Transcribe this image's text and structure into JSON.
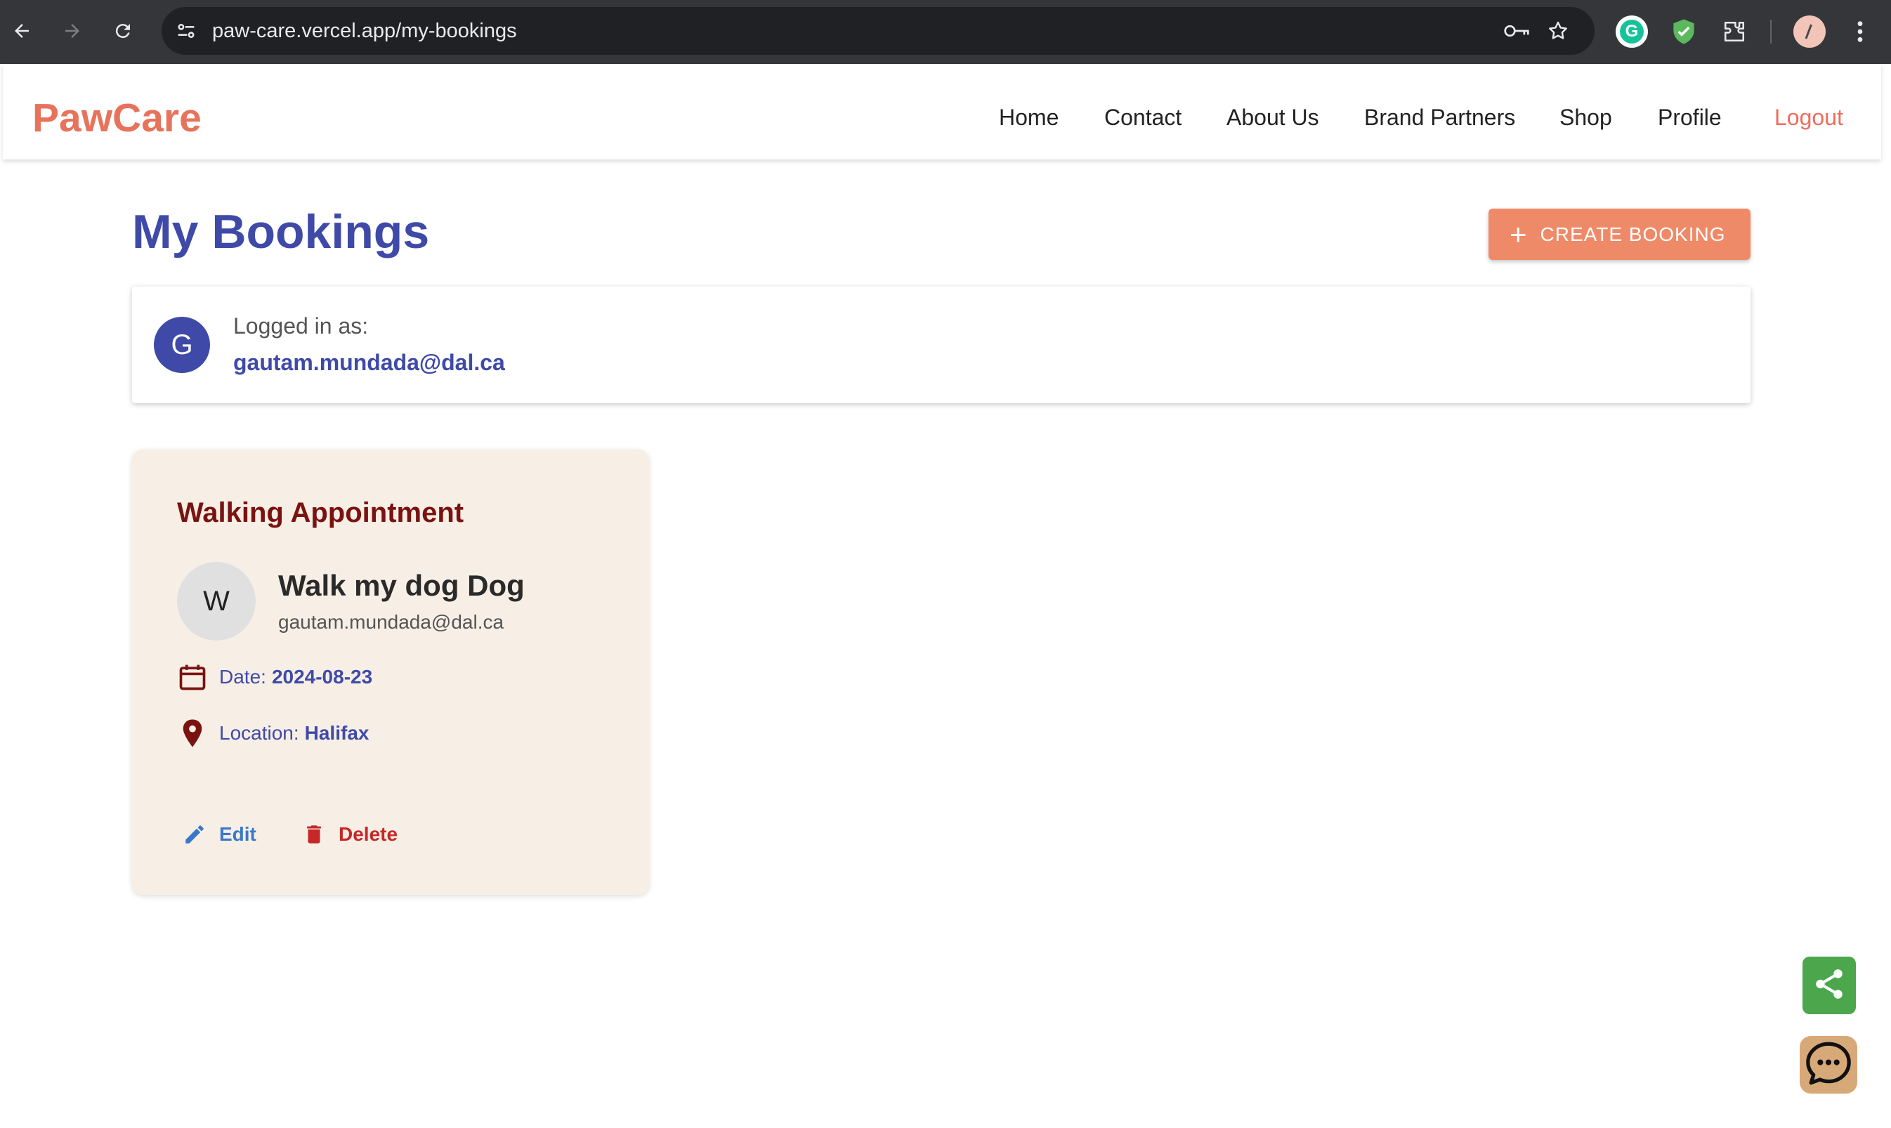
{
  "browser": {
    "url": "paw-care.vercel.app/my-bookings",
    "extensions": [
      "grammarly-icon",
      "shield-icon",
      "puzzle-icon"
    ],
    "colors": {
      "chrome_bg": "#35363a",
      "omnibox_bg": "#202124"
    }
  },
  "navbar": {
    "brand": "PawCare",
    "links": [
      "Home",
      "Contact",
      "About Us",
      "Brand Partners",
      "Shop",
      "Profile"
    ],
    "logout": "Logout",
    "colors": {
      "brand": "#e8735b",
      "logout": "#ef6c5a"
    }
  },
  "main": {
    "title": "My Bookings",
    "create_button": "CREATE BOOKING",
    "colors": {
      "title": "#3f4aa8",
      "create_button": "#ef8a68"
    }
  },
  "user": {
    "initial": "G",
    "label": "Logged in as:",
    "email": "gautam.mundada@dal.ca"
  },
  "bookings": [
    {
      "type": "Walking Appointment",
      "initial": "W",
      "title": "Walk my dog Dog",
      "email": "gautam.mundada@dal.ca",
      "date_label": "Date:",
      "date": "2024-08-23",
      "location_label": "Location:",
      "location": "Halifax",
      "edit_label": "Edit",
      "delete_label": "Delete",
      "colors": {
        "card_bg": "#f7efe6",
        "title": "#7a1310",
        "edit": "#3a78c9",
        "delete": "#c62828"
      }
    }
  ],
  "fabs": {
    "share_icon": "share-icon",
    "chat_icon": "chat-bubble-icon",
    "colors": {
      "share": "#4ca64c",
      "chat": "#d7a978"
    }
  }
}
